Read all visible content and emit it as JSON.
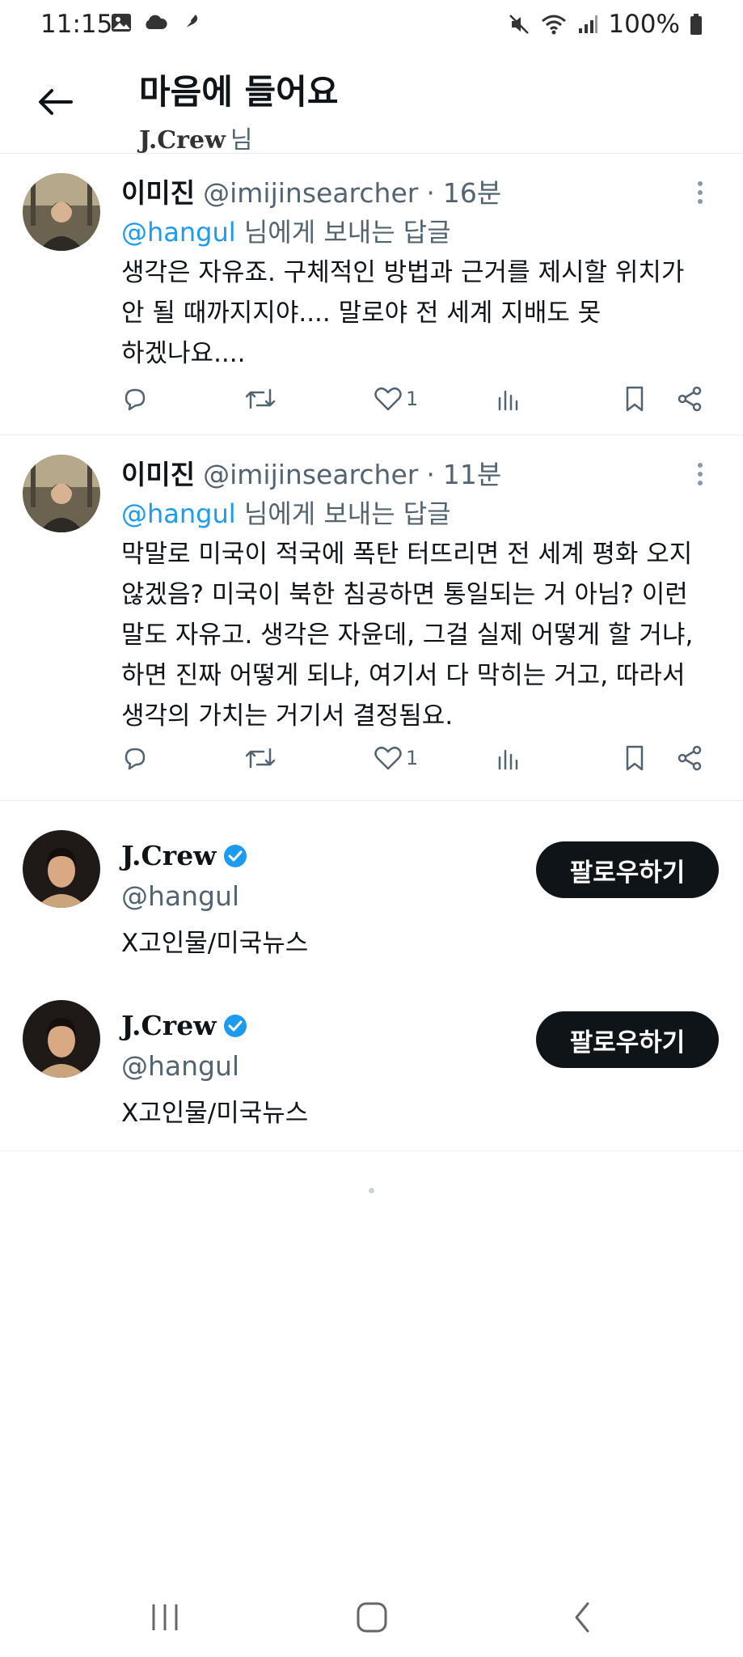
{
  "status_bar": {
    "time": "11:15",
    "battery": "100%"
  },
  "header": {
    "title": "마음에 들어요",
    "user_brand": "J.Crew",
    "user_suffix": "님"
  },
  "tweets": [
    {
      "name": "이미진",
      "handle": "@imijinsearcher",
      "sep": "·",
      "time": "16분",
      "mention": "@hangul",
      "reply_suffix": "님에게 보내는 답글",
      "lines": [
        "생각은 자유죠. 구체적인 방법과 근거를 제시할 위치가",
        "안 될 때까지지야.... 말로야 전 세계 지배도 못",
        "하겠나요...."
      ],
      "likes": "1"
    },
    {
      "name": "이미진",
      "handle": "@imijinsearcher",
      "sep": "·",
      "time": "11분",
      "mention": "@hangul",
      "reply_suffix": "님에게 보내는 답글",
      "lines": [
        "막말로 미국이 적국에 폭탄 터뜨리면 전 세계 평화 오지",
        "않겠음? 미국이 북한 침공하면 통일되는 거 아님? 이런",
        "말도 자유고. 생각은 자윤데, 그걸 실제 어떻게 할 거냐,",
        "하면 진짜 어떻게 되냐, 여기서 다 막히는 거고, 따라서",
        "생각의 가치는 거기서 결정됨요."
      ],
      "likes": "1"
    }
  ],
  "users": [
    {
      "name": "J.Crew",
      "handle": "@hangul",
      "bio": "X고인물/미국뉴스",
      "follow_label": "팔로우하기"
    },
    {
      "name": "J.Crew",
      "handle": "@hangul",
      "bio": "X고인물/미국뉴스",
      "follow_label": "팔로우하기"
    }
  ],
  "colors": {
    "accent": "#1d9bf0",
    "text": "#0f1419",
    "muted": "#536471",
    "button": "#0f1419"
  }
}
